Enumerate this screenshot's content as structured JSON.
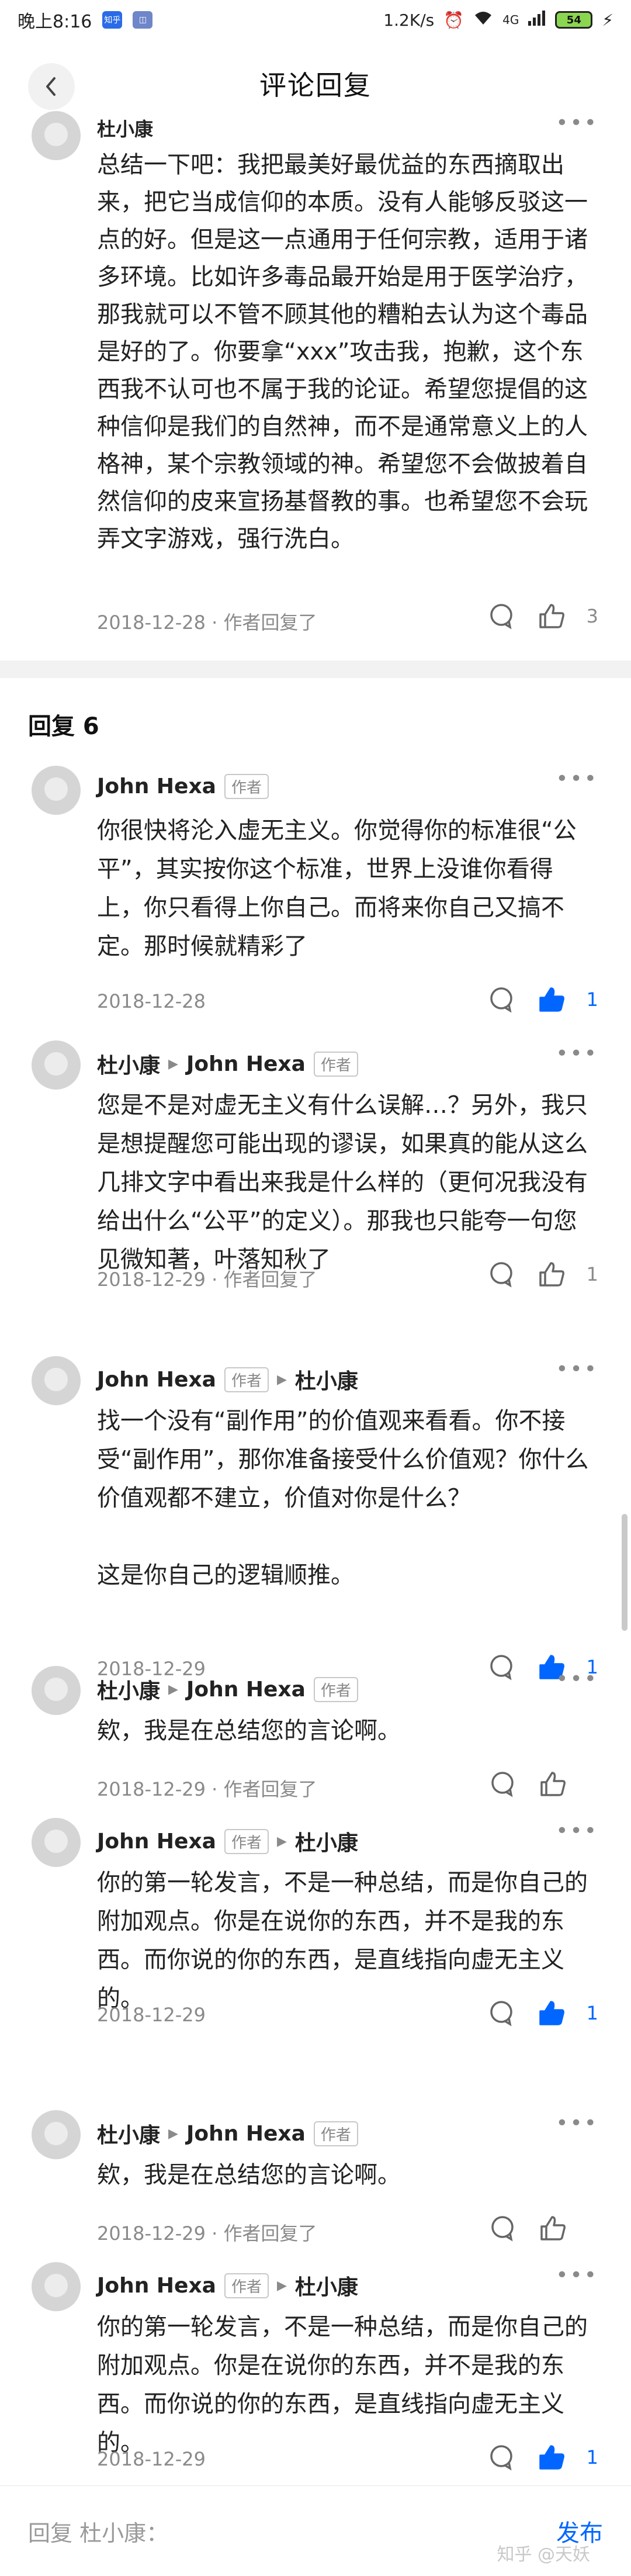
{
  "status_bar": {
    "time": "晚上8:16",
    "app_icon_1": "知乎",
    "app_icon_2": "◫",
    "network_speed": "1.2K/s",
    "signal": "4G",
    "battery": "54"
  },
  "nav": {
    "title": "评论回复",
    "back_icon": "chevron-left-icon"
  },
  "top_comment": {
    "author": "杜小康",
    "text": "总结一下吧：我把最美好最优益的东西摘取出来，把它当成信仰的本质。没有人能够反驳这一点的好。但是这一点通用于任何宗教，适用于诸多环境。比如许多毒品最开始是用于医学治疗，那我就可以不管不顾其他的糟粕去认为这个毒品是好的了。你要拿“xxx”攻击我，抱歉，这个东西我不认可也不属于我的论证。希望您提倡的这种信仰是我们的自然神，而不是通常意义上的人格神，某个宗教领域的神。希望您不会做披着自然信仰的皮来宣扬基督教的事。也希望您不会玩弄文字游戏，强行洗白。",
    "date": "2018-12-28 · 作者回复了",
    "likes": "3"
  },
  "section": {
    "title": "回复 6"
  },
  "replies": [
    {
      "author": "John Hexa",
      "author_tag": "作者",
      "target": "",
      "target_tag": "",
      "text": "你很快将沦入虚无主义。你觉得你的标准很“公平”，其实按你这个标准，世界上没谁你看得上，你只看得上你自己。而将来你自己又搞不定。那时候就精彩了",
      "date": "2018-12-28",
      "likes": "1",
      "liked": true
    },
    {
      "author": "杜小康",
      "author_tag": "",
      "target": "John Hexa",
      "target_tag": "作者",
      "text": "您是不是对虚无主义有什么误解…？另外，我只是想提醒您可能出现的谬误，如果真的能从这么几排文字中看出来我是什么样的（更何况我没有给出什么“公平”的定义）。那我也只能夸一句您见微知著，叶落知秋了",
      "date": "2018-12-29 · 作者回复了",
      "likes": "1",
      "liked": false
    },
    {
      "author": "John Hexa",
      "author_tag": "作者",
      "target": "杜小康",
      "target_tag": "",
      "text": "找一个没有“副作用”的价值观来看看。你不接受“副作用”，那你准备接受什么价值观？你什么价值观都不建立，价值对你是什么？\n\n这是你自己的逻辑顺推。",
      "date": "2018-12-29",
      "likes": "1",
      "liked": true
    },
    {
      "author": "杜小康",
      "author_tag": "",
      "target": "John Hexa",
      "target_tag": "作者",
      "text": "欸，我是在总结您的言论啊。",
      "date": "2018-12-29 · 作者回复了",
      "likes": "",
      "liked": false
    },
    {
      "author": "John Hexa",
      "author_tag": "作者",
      "target": "杜小康",
      "target_tag": "",
      "text": "你的第一轮发言，不是一种总结，而是你自己的附加观点。你是在说你的东西，并不是我的东西。而你说的你的东西，是直线指向虚无主义的。",
      "date": "2018-12-29",
      "likes": "1",
      "liked": true
    },
    {
      "author": "杜小康",
      "author_tag": "",
      "target": "John Hexa",
      "target_tag": "作者",
      "text": "欸，我是在总结您的言论啊。",
      "date": "2018-12-29 · 作者回复了",
      "likes": "",
      "liked": false
    },
    {
      "author": "John Hexa",
      "author_tag": "作者",
      "target": "杜小康",
      "target_tag": "",
      "text": "你的第一轮发言，不是一种总结，而是你自己的附加观点。你是在说你的东西，并不是我的东西。而你说的你的东西，是直线指向虚无主义的。",
      "date": "2018-12-29",
      "likes": "1",
      "liked": true
    }
  ],
  "bottom_bar": {
    "input_placeholder": "回复 杜小康：",
    "send_label": "发布"
  },
  "watermark": "知乎 @天妖",
  "colors": {
    "accent": "#0066ff",
    "meta_gray": "#8a8a8a",
    "band_gray": "#f2f2f2"
  }
}
